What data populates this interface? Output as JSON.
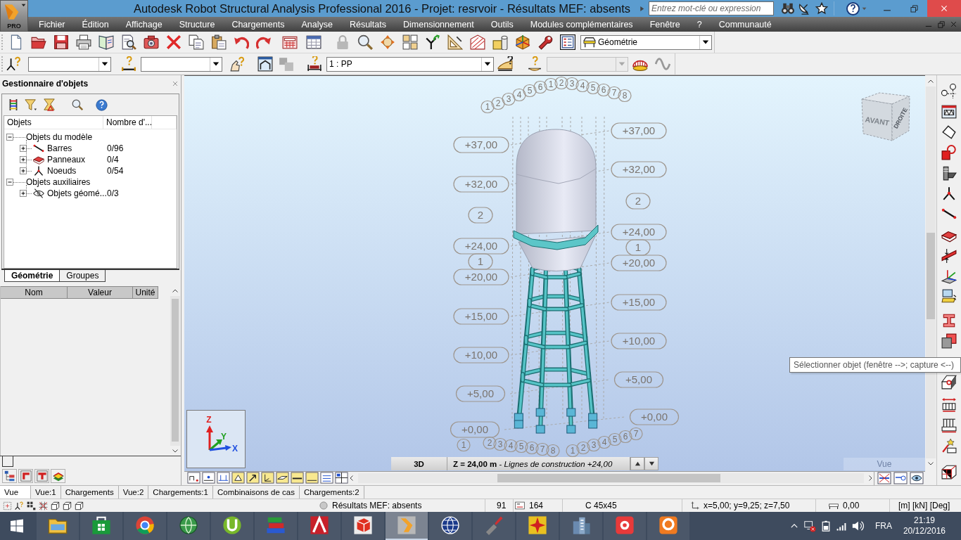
{
  "window": {
    "logo_text": "PRO",
    "title": "Autodesk Robot Structural Analysis Professional 2016 - Projet: resrvoir - Résultats MEF: absents",
    "search": {
      "placeholder": "Entrez mot-clé ou expression"
    }
  },
  "menu": [
    "Fichier",
    "Édition",
    "Affichage",
    "Structure",
    "Chargements",
    "Analyse",
    "Résultats",
    "Dimensionnement",
    "Outils",
    "Modules complémentaires",
    "Fenêtre",
    "?",
    "Communauté"
  ],
  "toolbar": {
    "view_combo": {
      "value": "Géométrie"
    },
    "combos": [
      {
        "disabled": false
      },
      {
        "disabled": false
      },
      {
        "value": "1 : PP",
        "disabled": false
      },
      {
        "disabled": true
      }
    ]
  },
  "object_manager": {
    "title": "Gestionnaire d'objets",
    "columns": [
      "Objets",
      "Nombre d'..."
    ],
    "tree": [
      {
        "label": "Objets du modèle",
        "expanded": true,
        "children": [
          {
            "label": "Barres",
            "kind": "bar",
            "count": "0/96",
            "expanded": false
          },
          {
            "label": "Panneaux",
            "kind": "panel",
            "count": "0/4",
            "expanded": false
          },
          {
            "label": "Noeuds",
            "kind": "node",
            "count": "0/54",
            "expanded": false
          }
        ]
      },
      {
        "label": "Objets auxiliaires",
        "expanded": true,
        "children": [
          {
            "label": "Objets géomé...",
            "kind": "auxiliary",
            "count": "0/3",
            "expanded": false
          }
        ]
      }
    ],
    "tabs": [
      {
        "label": "Géométrie",
        "selected": true
      },
      {
        "label": "Groupes",
        "selected": false
      }
    ],
    "property_columns": [
      "Nom",
      "Valeur",
      "Unité"
    ]
  },
  "viewport": {
    "top_axis_labels": [
      "1",
      "2",
      "3",
      "4",
      "5",
      "6",
      "1",
      "2",
      "3",
      "4",
      "5",
      "6",
      "7",
      "8"
    ],
    "left_level_labels": [
      "+37,00",
      "+32,00",
      "+24,00",
      "+20,00",
      "+15,00",
      "+10,00",
      "+5,00",
      "+0,00"
    ],
    "left_axis_labels": [
      "2",
      "1"
    ],
    "right_level_labels": [
      "+37,00",
      "+32,00",
      "+24,00",
      "+20,00",
      "+15,00",
      "+10,00",
      "+5,00",
      "+0,00"
    ],
    "right_axis_labels": [
      "2",
      "1"
    ],
    "bottom_left_axis_labels": [
      "1",
      "2",
      "3",
      "4",
      "5",
      "6",
      "7",
      "8"
    ],
    "bottom_right_axis_labels": [
      "1",
      "2",
      "3",
      "4",
      "5",
      "6",
      "7"
    ],
    "view_cube": {
      "front": "AVANT",
      "right": "DROITE"
    },
    "axes": [
      "Z",
      "Y",
      "X"
    ],
    "mode": "3D",
    "construction_line": "**Z = 24,00 m** - *Lignes de construction +24,00*",
    "view_name": "Vue"
  },
  "tooltip": "Sélectionner objet (fenêtre -->; capture <--)",
  "view_tabs": [
    {
      "label": "Vue",
      "selected": true
    },
    {
      "label": "Vue:1",
      "selected": false
    },
    {
      "label": "Chargements",
      "selected": false
    },
    {
      "label": "Vue:2",
      "selected": false
    },
    {
      "label": "Chargements:1",
      "selected": false
    },
    {
      "label": "Combinaisons de cas",
      "selected": false
    },
    {
      "label": "Chargements:2",
      "selected": false
    }
  ],
  "status_bar": {
    "results": "Résultats MEF: absents",
    "field_1": "91",
    "field_2": "164",
    "section": "C 45x45",
    "coordinates": "x=5,00; y=9,25; z=7,50",
    "field_3": "0,00",
    "units": "[m] [kN] [Deg]"
  },
  "taskbar": {
    "apps": [
      {
        "selected": false
      },
      {
        "selected": false
      },
      {
        "selected": false
      },
      {
        "selected": false
      },
      {
        "selected": false
      },
      {
        "selected": false
      },
      {
        "selected": false
      },
      {
        "selected": false
      },
      {
        "selected": true
      },
      {
        "selected": false
      },
      {
        "selected": false
      },
      {
        "selected": false
      },
      {
        "selected": false
      },
      {
        "selected": false
      },
      {
        "selected": false
      }
    ],
    "language": "FRA",
    "time": "21:19",
    "date": "20/12/2016"
  }
}
